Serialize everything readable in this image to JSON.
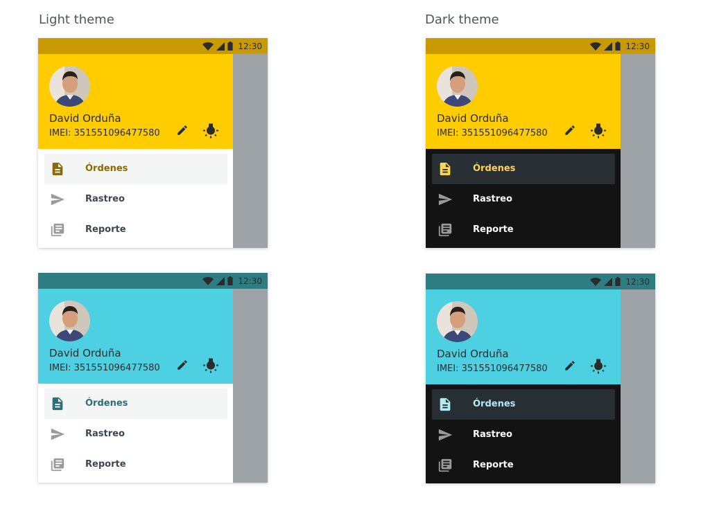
{
  "titles": {
    "light": "Light theme",
    "dark": "Dark theme"
  },
  "status": {
    "time": "12:30",
    "icons": [
      "wifi-icon",
      "signal-icon",
      "battery-icon"
    ]
  },
  "user": {
    "name": "David Orduña",
    "imei": "IMEI: 351551096477580"
  },
  "header_icons": [
    "edit-pencil-icon",
    "lightbulb-icon"
  ],
  "menu": [
    {
      "label": "Órdenes",
      "icon": "document-icon",
      "selected": true
    },
    {
      "label": "Rastreo",
      "icon": "send-icon",
      "selected": false
    },
    {
      "label": "Reporte",
      "icon": "library-books-icon",
      "selected": false
    }
  ],
  "themes": {
    "yellow": {
      "statusbar": "#c99a00",
      "header": "#ffcc00",
      "accent_light": "#8a6a00",
      "accent_dark": "#ffd54f",
      "status_text": "#2b2b2b"
    },
    "cyan": {
      "statusbar": "#2e7d83",
      "header": "#4dd0e1",
      "accent_light": "#2e6e76",
      "accent_dark": "#b2ebf2",
      "status_text": "#2b2b2b"
    }
  }
}
